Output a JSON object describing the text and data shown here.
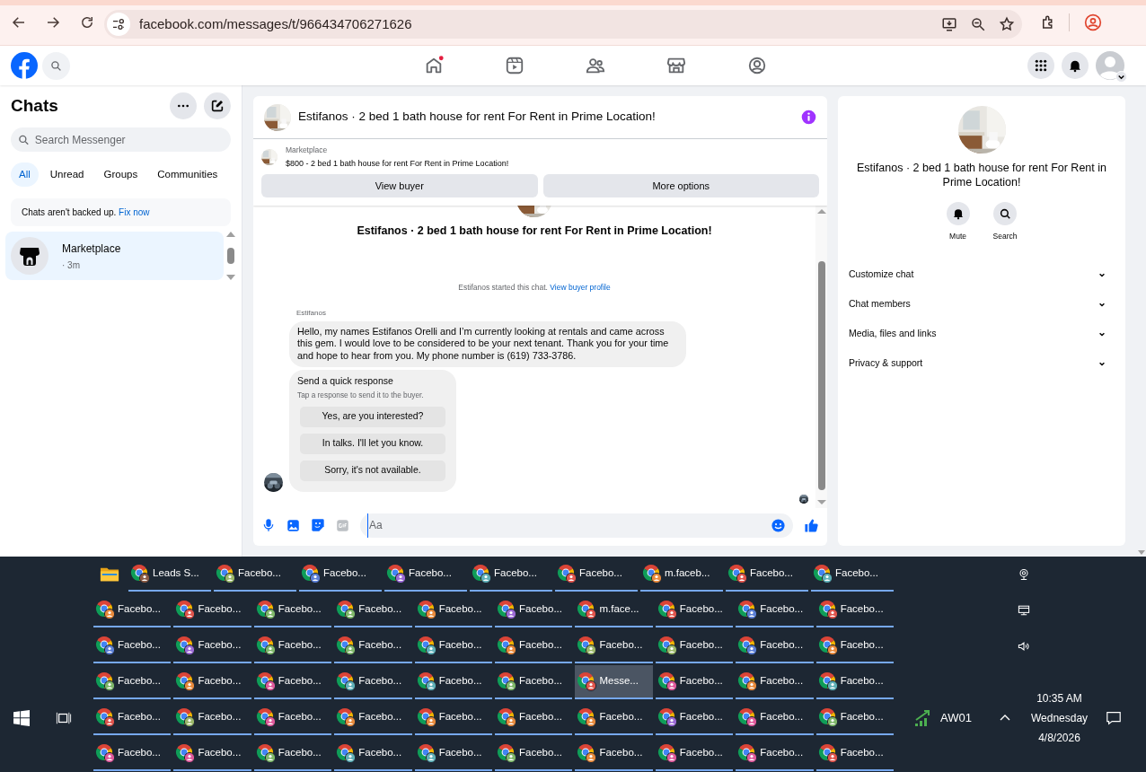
{
  "browser": {
    "url": "facebook.com/messages/t/966434706271626"
  },
  "fb_nav": [
    {
      "badge": true
    },
    {
      "badge": false
    },
    {
      "badge": false
    },
    {
      "badge": false
    },
    {
      "badge": false
    }
  ],
  "sidebar": {
    "title": "Chats",
    "search": {
      "placeholder": "Search Messenger"
    },
    "filters": [
      {
        "label": "All",
        "selected": true
      },
      {
        "label": "Unread",
        "selected": false
      },
      {
        "label": "Groups",
        "selected": false
      },
      {
        "label": "Communities",
        "selected": false
      }
    ],
    "backup_notice": {
      "text": "Chats aren't backed up.",
      "link": "Fix now"
    },
    "chats": [
      {
        "name": "Marketplace",
        "time": "· 3m",
        "selected": true
      }
    ]
  },
  "conversation": {
    "title": "Estifanos · 2 bed 1 bath house for rent For Rent in Prime Location!",
    "listing": {
      "label": "Marketplace",
      "text": "$800 - 2 bed 1 bath house for rent For Rent in Prime Location!"
    },
    "buttons": [
      "View buyer",
      "More options"
    ],
    "intro_title": "Estifanos · 2 bed 1 bath house for rent For Rent in Prime Location!",
    "system_note": {
      "text": "Estifanos started this chat.",
      "link": "View buyer profile"
    },
    "message": {
      "sender": "Estifanos",
      "text": "Hello, my names Estifanos Orelli and I’m currently looking at rentals and came across this gem. I would love to be considered to be your next tenant. Thank you for your time and hope to hear from you. My phone number is (619) 733-3786."
    },
    "quick_response": {
      "title": "Send a quick response",
      "subtitle": "Tap a response to send it to the buyer.",
      "options": [
        "Yes, are you interested?",
        "In talks. I'll let you know.",
        "Sorry, it's not available."
      ]
    },
    "composer": {
      "placeholder": "Aa"
    }
  },
  "details": {
    "title": "Estifanos · 2 bed 1 bath house for rent For Rent in Prime Location!",
    "actions": [
      {
        "label": "Mute"
      },
      {
        "label": "Search"
      }
    ],
    "sections": [
      {
        "label": "Customize chat",
        "expanded": false
      },
      {
        "label": "Chat members",
        "expanded": false
      },
      {
        "label": "Media, files and links",
        "expanded": false
      },
      {
        "label": "Privacy & support",
        "expanded": false
      }
    ]
  },
  "taskbar": {
    "rows": [
      [
        {
          "kind": "folder"
        },
        {
          "kind": "browser",
          "label": "Leads S...",
          "color": "#8a5a44",
          "selected": false
        },
        {
          "kind": "browser",
          "label": "Facebo...",
          "color": "#9bb86a",
          "selected": false
        },
        {
          "kind": "browser",
          "label": "Facebo...",
          "color": "#5b7fd6",
          "selected": false
        },
        {
          "kind": "browser",
          "label": "Facebo...",
          "color": "#9b6ad6",
          "selected": false
        },
        {
          "kind": "browser",
          "label": "Facebo...",
          "color": "#5fb0b8",
          "selected": false
        },
        {
          "kind": "browser",
          "label": "Facebo...",
          "color": "#e0544c",
          "selected": false
        },
        {
          "kind": "browser",
          "label": "m.faceb...",
          "color": "#e88a3c",
          "selected": false
        },
        {
          "kind": "browser",
          "label": "Facebo...",
          "color": "#e0544c",
          "selected": false
        },
        {
          "kind": "browser",
          "label": "Facebo...",
          "color": "#5fb0b8",
          "selected": false
        }
      ],
      [
        {
          "kind": "browser",
          "label": "Facebo...",
          "color": "#e88a3c",
          "selected": false
        },
        {
          "kind": "browser",
          "label": "Facebo...",
          "color": "#e0544c",
          "selected": false
        },
        {
          "kind": "browser",
          "label": "Facebo...",
          "color": "#7fb86a",
          "selected": false
        },
        {
          "kind": "browser",
          "label": "Facebo...",
          "color": "#7fb86a",
          "selected": false
        },
        {
          "kind": "browser",
          "label": "Facebo...",
          "color": "#e88a3c",
          "selected": false
        },
        {
          "kind": "browser",
          "label": "Facebo...",
          "color": "#9b6ad6",
          "selected": false
        },
        {
          "kind": "browser",
          "label": "m.face...",
          "color": "#e0544c",
          "selected": false
        },
        {
          "kind": "browser",
          "label": "Facebo...",
          "color": "#e0544c",
          "selected": false
        },
        {
          "kind": "browser",
          "label": "Facebo...",
          "color": "#5b7fd6",
          "selected": false
        },
        {
          "kind": "browser",
          "label": "Facebo...",
          "color": "#e0544c",
          "selected": false
        }
      ],
      [
        {
          "kind": "browser",
          "label": "Facebo...",
          "color": "#5b7fd6",
          "selected": false
        },
        {
          "kind": "browser",
          "label": "Facebo...",
          "color": "#9b6ad6",
          "selected": false
        },
        {
          "kind": "browser",
          "label": "Facebo...",
          "color": "#7fb86a",
          "selected": false
        },
        {
          "kind": "browser",
          "label": "Facebo...",
          "color": "#7fb86a",
          "selected": false
        },
        {
          "kind": "browser",
          "label": "Facebo...",
          "color": "#5fb0b8",
          "selected": false
        },
        {
          "kind": "browser",
          "label": "Facebo...",
          "color": "#e88a3c",
          "selected": false
        },
        {
          "kind": "browser",
          "label": "Facebo...",
          "color": "#9bb86a",
          "selected": false
        },
        {
          "kind": "browser",
          "label": "Facebo...",
          "color": "#9bb86a",
          "selected": false
        },
        {
          "kind": "browser",
          "label": "Facebo...",
          "color": "#5b7fd6",
          "selected": false
        },
        {
          "kind": "browser",
          "label": "Facebo...",
          "color": "#e88a3c",
          "selected": false
        }
      ],
      [
        {
          "kind": "browser",
          "label": "Facebo...",
          "color": "#7fb86a",
          "selected": false
        },
        {
          "kind": "browser",
          "label": "Facebo...",
          "color": "#e88a3c",
          "selected": false
        },
        {
          "kind": "browser",
          "label": "Facebo...",
          "color": "#e05a9c",
          "selected": false
        },
        {
          "kind": "browser",
          "label": "Facebo...",
          "color": "#5fb0b8",
          "selected": false
        },
        {
          "kind": "browser",
          "label": "Facebo...",
          "color": "#5fb0b8",
          "selected": false
        },
        {
          "kind": "browser",
          "label": "Facebo...",
          "color": "#7fb86a",
          "selected": false
        },
        {
          "kind": "browser",
          "label": "Messe...",
          "color": "#e0544c",
          "selected": true
        },
        {
          "kind": "browser",
          "label": "Facebo...",
          "color": "#e05a9c",
          "selected": false
        },
        {
          "kind": "browser",
          "label": "Facebo...",
          "color": "#e88a3c",
          "selected": false
        },
        {
          "kind": "browser",
          "label": "Facebo...",
          "color": "#5fb0b8",
          "selected": false
        }
      ],
      [
        {
          "kind": "browser",
          "label": "Facebo...",
          "color": "#e0544c",
          "selected": false
        },
        {
          "kind": "browser",
          "label": "Facebo...",
          "color": "#9bb86a",
          "selected": false
        },
        {
          "kind": "browser",
          "label": "Facebo...",
          "color": "#e05a9c",
          "selected": false
        },
        {
          "kind": "browser",
          "label": "Facebo...",
          "color": "#e88a3c",
          "selected": false
        },
        {
          "kind": "browser",
          "label": "Facebo...",
          "color": "#e88a3c",
          "selected": false
        },
        {
          "kind": "browser",
          "label": "Facebo...",
          "color": "#e88a3c",
          "selected": false
        },
        {
          "kind": "browser",
          "label": "Facebo...",
          "color": "#e88a3c",
          "selected": false
        },
        {
          "kind": "browser",
          "label": "Facebo...",
          "color": "#9b6ad6",
          "selected": false
        },
        {
          "kind": "browser",
          "label": "Facebo...",
          "color": "#e05a9c",
          "selected": false
        },
        {
          "kind": "browser",
          "label": "Facebo...",
          "color": "#7fb86a",
          "selected": false
        }
      ],
      [
        {
          "kind": "browser",
          "label": "Facebo...",
          "color": "#e05a9c",
          "selected": false
        },
        {
          "kind": "browser",
          "label": "Facebo...",
          "color": "#e05a9c",
          "selected": false
        },
        {
          "kind": "browser",
          "label": "Facebo...",
          "color": "#7fb86a",
          "selected": false
        },
        {
          "kind": "browser",
          "label": "Facebo...",
          "color": "#5fb0b8",
          "selected": false
        },
        {
          "kind": "browser",
          "label": "Facebo...",
          "color": "#5fb0b8",
          "selected": false
        },
        {
          "kind": "browser",
          "label": "Facebo...",
          "color": "#7fb86a",
          "selected": false
        },
        {
          "kind": "browser",
          "label": "Facebo...",
          "color": "#e88a3c",
          "selected": false
        },
        {
          "kind": "browser",
          "label": "Facebo...",
          "color": "#e05a9c",
          "selected": false
        },
        {
          "kind": "browser",
          "label": "Facebo...",
          "color": "#e05a9c",
          "selected": false
        },
        {
          "kind": "browser",
          "label": "Facebo...",
          "color": "#e0544c",
          "selected": false
        }
      ]
    ],
    "network": "AW01",
    "clock": {
      "time": "10:35 AM",
      "day": "Wednesday",
      "date": "4/8/2026"
    }
  }
}
